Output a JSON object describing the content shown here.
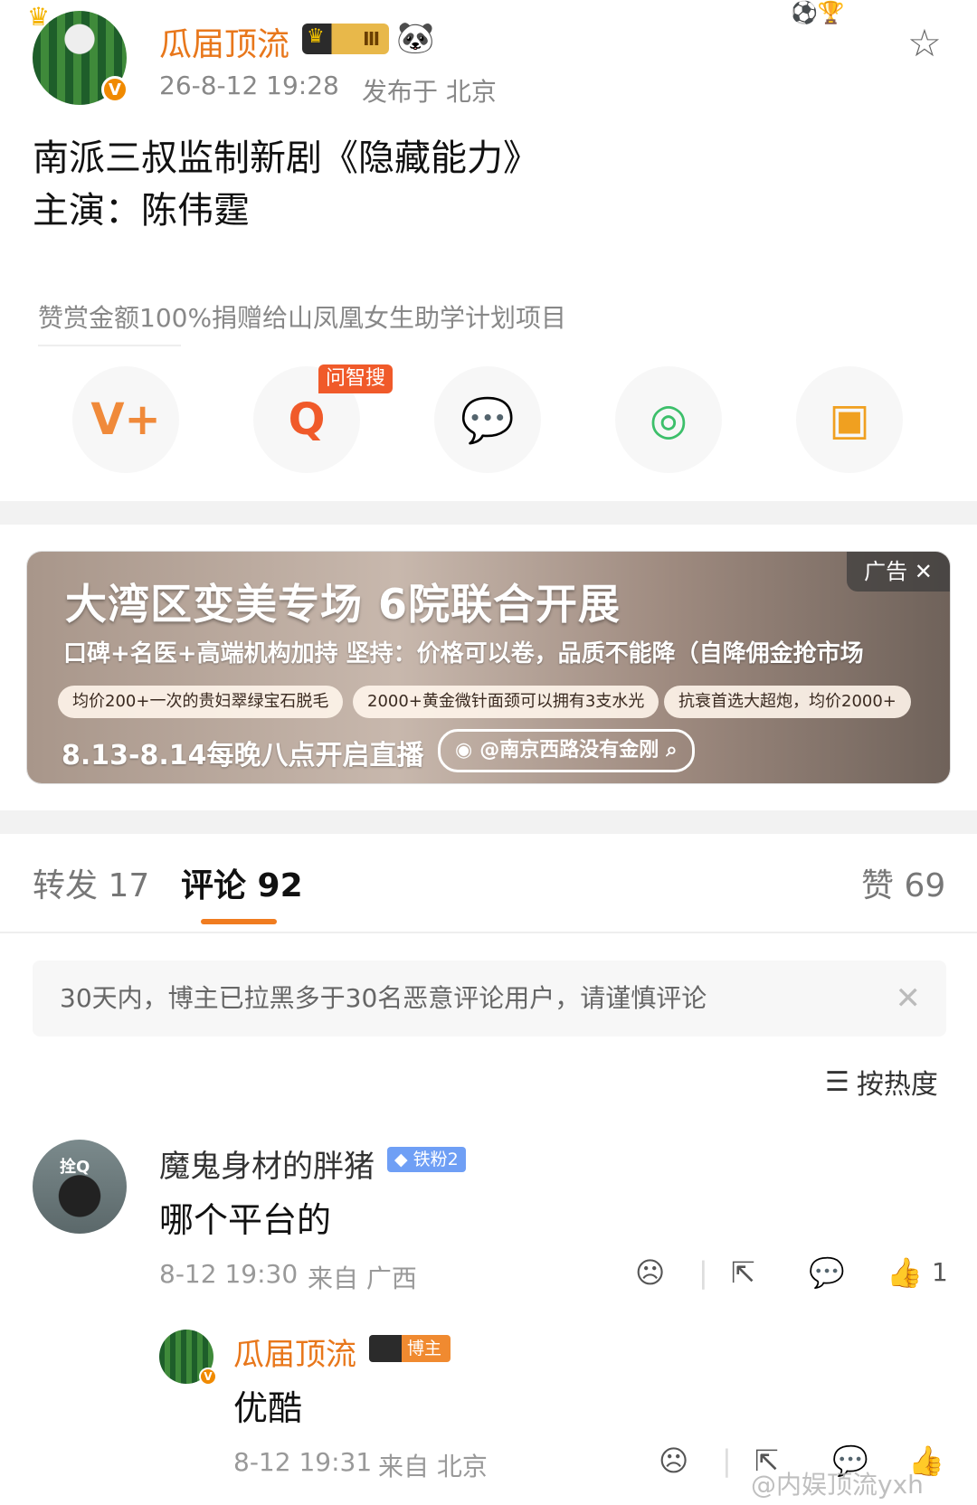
{
  "post": {
    "author": "瓜届顶流",
    "vip_level": "Ⅲ",
    "time": "26-8-12 19:28",
    "location": "发布于 北京",
    "body_line1": "南派三叔监制新剧《隐藏能力》",
    "body_line2": "主演：陈伟霆",
    "reward_note": "赞赏金额100%捐赠给山凤凰女生助学计划项目"
  },
  "share": {
    "new_tag": "问智搜",
    "items": [
      {
        "icon": "v-plus-icon",
        "color": "#f08a3a"
      },
      {
        "icon": "ai-search-icon",
        "color": "#f05a2a"
      },
      {
        "icon": "wechat-icon",
        "color": "#3cbf6a"
      },
      {
        "icon": "moments-icon",
        "color": "#3cbf6a"
      },
      {
        "icon": "save-image-icon",
        "color": "#f0a020"
      }
    ]
  },
  "ad": {
    "title": "大湾区变美专场 6院联合开展",
    "subtitle": "口碑+名医+高端机构加持   坚持：价格可以卷，品质不能降（自降佣金抢市场",
    "pills": [
      "均价200+一次的贵妇翠绿宝石脱毛",
      "2000+黄金微针面颈可以拥有3支水光",
      "抗衰首选大超炮，均价2000+"
    ],
    "live": "8.13-8.14每晚八点开启直播",
    "handle": "@南京西路没有金刚",
    "tag": "广告 ✕"
  },
  "tabs": {
    "repost": "转发 17",
    "comment": "评论 92",
    "like": "赞 69"
  },
  "notice": "30天内，博主已拉黑多于30名恶意评论用户，请谨慎评论",
  "sort_label": "按热度",
  "comments": [
    {
      "avatar_tag": "拴Q",
      "name": "魔鬼身材的胖猪",
      "fan_badge": "◆ 铁粉2",
      "text": "哪个平台的",
      "time": "8-12 19:30",
      "location": "来自 广西",
      "like_count": "1"
    }
  ],
  "reply": {
    "name": "瓜届顶流",
    "badge": "博主",
    "text": "优酷",
    "time": "8-12 19:31",
    "location": "来自 北京"
  },
  "watermark": "@内娱顶流yxh",
  "colors": {
    "accent": "#e8771b",
    "tab_underline": "#f07c20",
    "fan_badge": "#6f9ff5"
  }
}
